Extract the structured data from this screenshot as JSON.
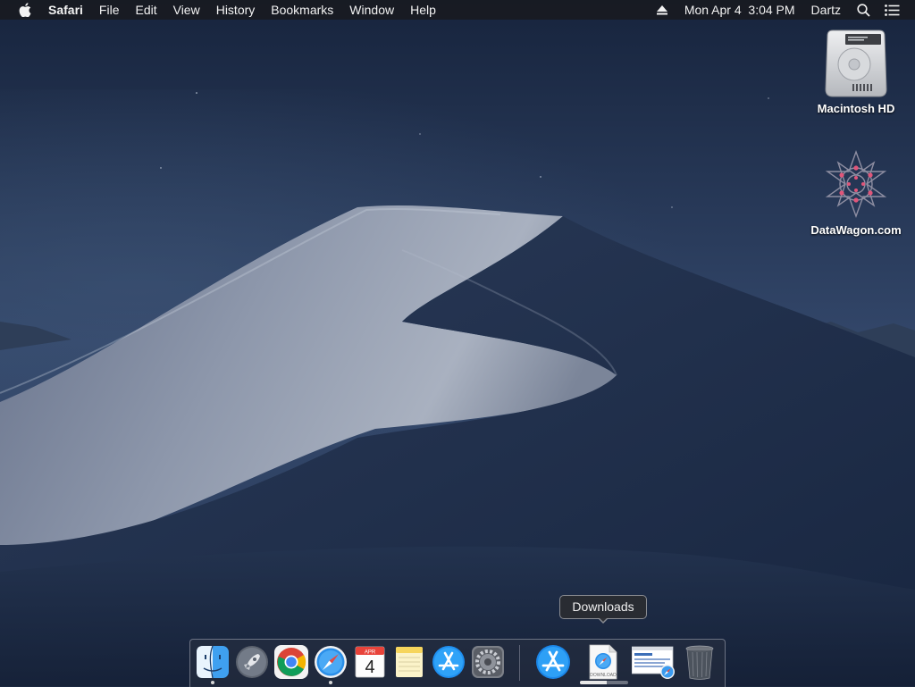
{
  "menubar": {
    "apple_icon": "apple-logo-icon",
    "app_name": "Safari",
    "menus": [
      "File",
      "Edit",
      "View",
      "History",
      "Bookmarks",
      "Window",
      "Help"
    ],
    "eject_icon": "eject-icon",
    "datetime": "Mon Apr 4  3:04 PM",
    "user": "Dartz",
    "search_icon": "spotlight-search-icon",
    "notifications_icon": "notification-center-icon"
  },
  "desktop": {
    "icons": [
      {
        "label": "Macintosh HD",
        "icon": "hard-drive-icon"
      },
      {
        "label": "DataWagon.com",
        "icon": "datawagon-logo-icon"
      }
    ]
  },
  "tooltip": {
    "text": "Downloads"
  },
  "dock": {
    "apps": [
      {
        "name": "Finder",
        "icon": "finder-icon",
        "running": true
      },
      {
        "name": "Launchpad",
        "icon": "launchpad-rocket-icon",
        "running": false
      },
      {
        "name": "Google Chrome",
        "icon": "chrome-icon",
        "running": false
      },
      {
        "name": "Safari",
        "icon": "safari-compass-icon",
        "running": true
      },
      {
        "name": "Calendar",
        "icon": "calendar-icon",
        "running": false,
        "month": "APR",
        "day": "4"
      },
      {
        "name": "Notes",
        "icon": "notes-icon",
        "running": false
      },
      {
        "name": "App Store",
        "icon": "app-store-icon",
        "running": false
      },
      {
        "name": "System Preferences",
        "icon": "gear-icon",
        "running": false
      }
    ],
    "others": [
      {
        "name": "Applications",
        "icon": "app-store-folder-icon"
      },
      {
        "name": "Downloads",
        "icon": "download-file-icon",
        "file_label": "DOWNLOAD",
        "progress": 0.55
      },
      {
        "name": "Document",
        "icon": "safari-document-icon"
      },
      {
        "name": "Trash",
        "icon": "trash-icon"
      }
    ]
  },
  "colors": {
    "sky_top": "#1a2a45",
    "sky_mid": "#2f4260",
    "dune_light": "#9aa3b3",
    "dune_dark": "#1b2b48",
    "menubar_bg": "#181a20"
  }
}
